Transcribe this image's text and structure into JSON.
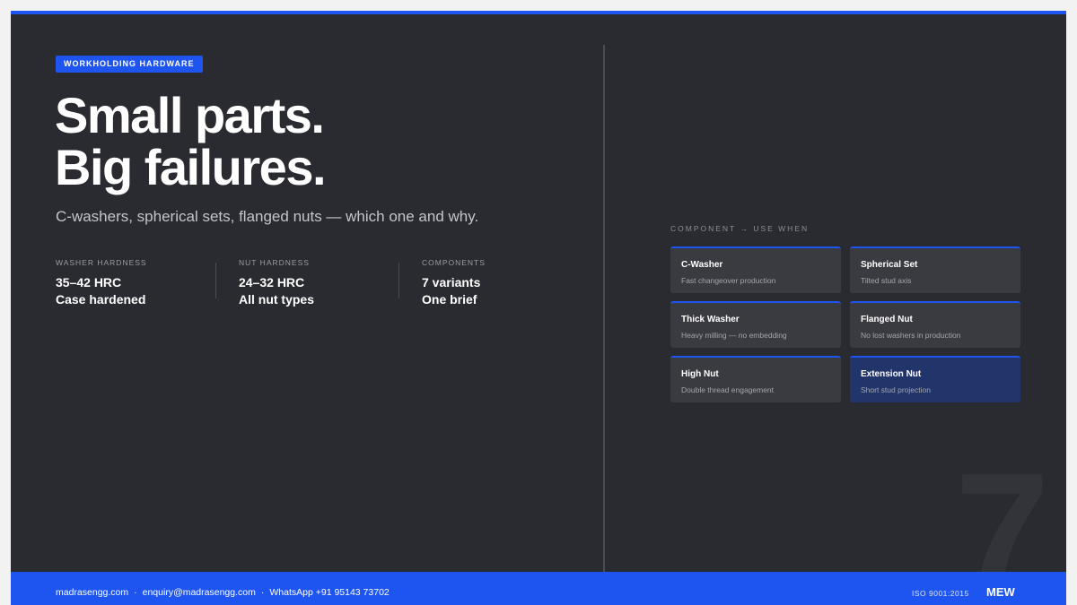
{
  "tag": "WORKHOLDING HARDWARE",
  "headline": [
    "Small parts.",
    "Big failures."
  ],
  "subtitle": "C-washers, spherical sets, flanged nuts — which one and why.",
  "stats": [
    {
      "label": "WASHER HARDNESS",
      "value": "35–42 HRC",
      "note": "Case hardened"
    },
    {
      "label": "NUT HARDNESS",
      "value": "24–32 HRC",
      "note": "All nut types"
    },
    {
      "label": "COMPONENTS",
      "value": "7 variants",
      "note": "One brief"
    }
  ],
  "components_label": "COMPONENT → USE WHEN",
  "components": [
    {
      "name": "C-Washer",
      "use": "Fast changeover production"
    },
    {
      "name": "Spherical Set",
      "use": "Tilted stud axis"
    },
    {
      "name": "Thick Washer",
      "use": "Heavy milling — no embedding"
    },
    {
      "name": "Flanged Nut",
      "use": "No lost washers in production"
    },
    {
      "name": "High Nut",
      "use": "Double thread engagement"
    },
    {
      "name": "Extension Nut",
      "use": "Short stud projection"
    }
  ],
  "page_number": "7",
  "footer": {
    "website": "madrasengg.com",
    "email": "enquiry@madrasengg.com",
    "whatsapp": "WhatsApp +91 95143 73702",
    "separator": "·",
    "certification": "ISO 9001:2015",
    "brand": "MEW"
  },
  "colors": {
    "accent": "#1e54f0",
    "background": "#2a2b31",
    "card": "#3a3b41",
    "card_highlight": "#22356b"
  }
}
